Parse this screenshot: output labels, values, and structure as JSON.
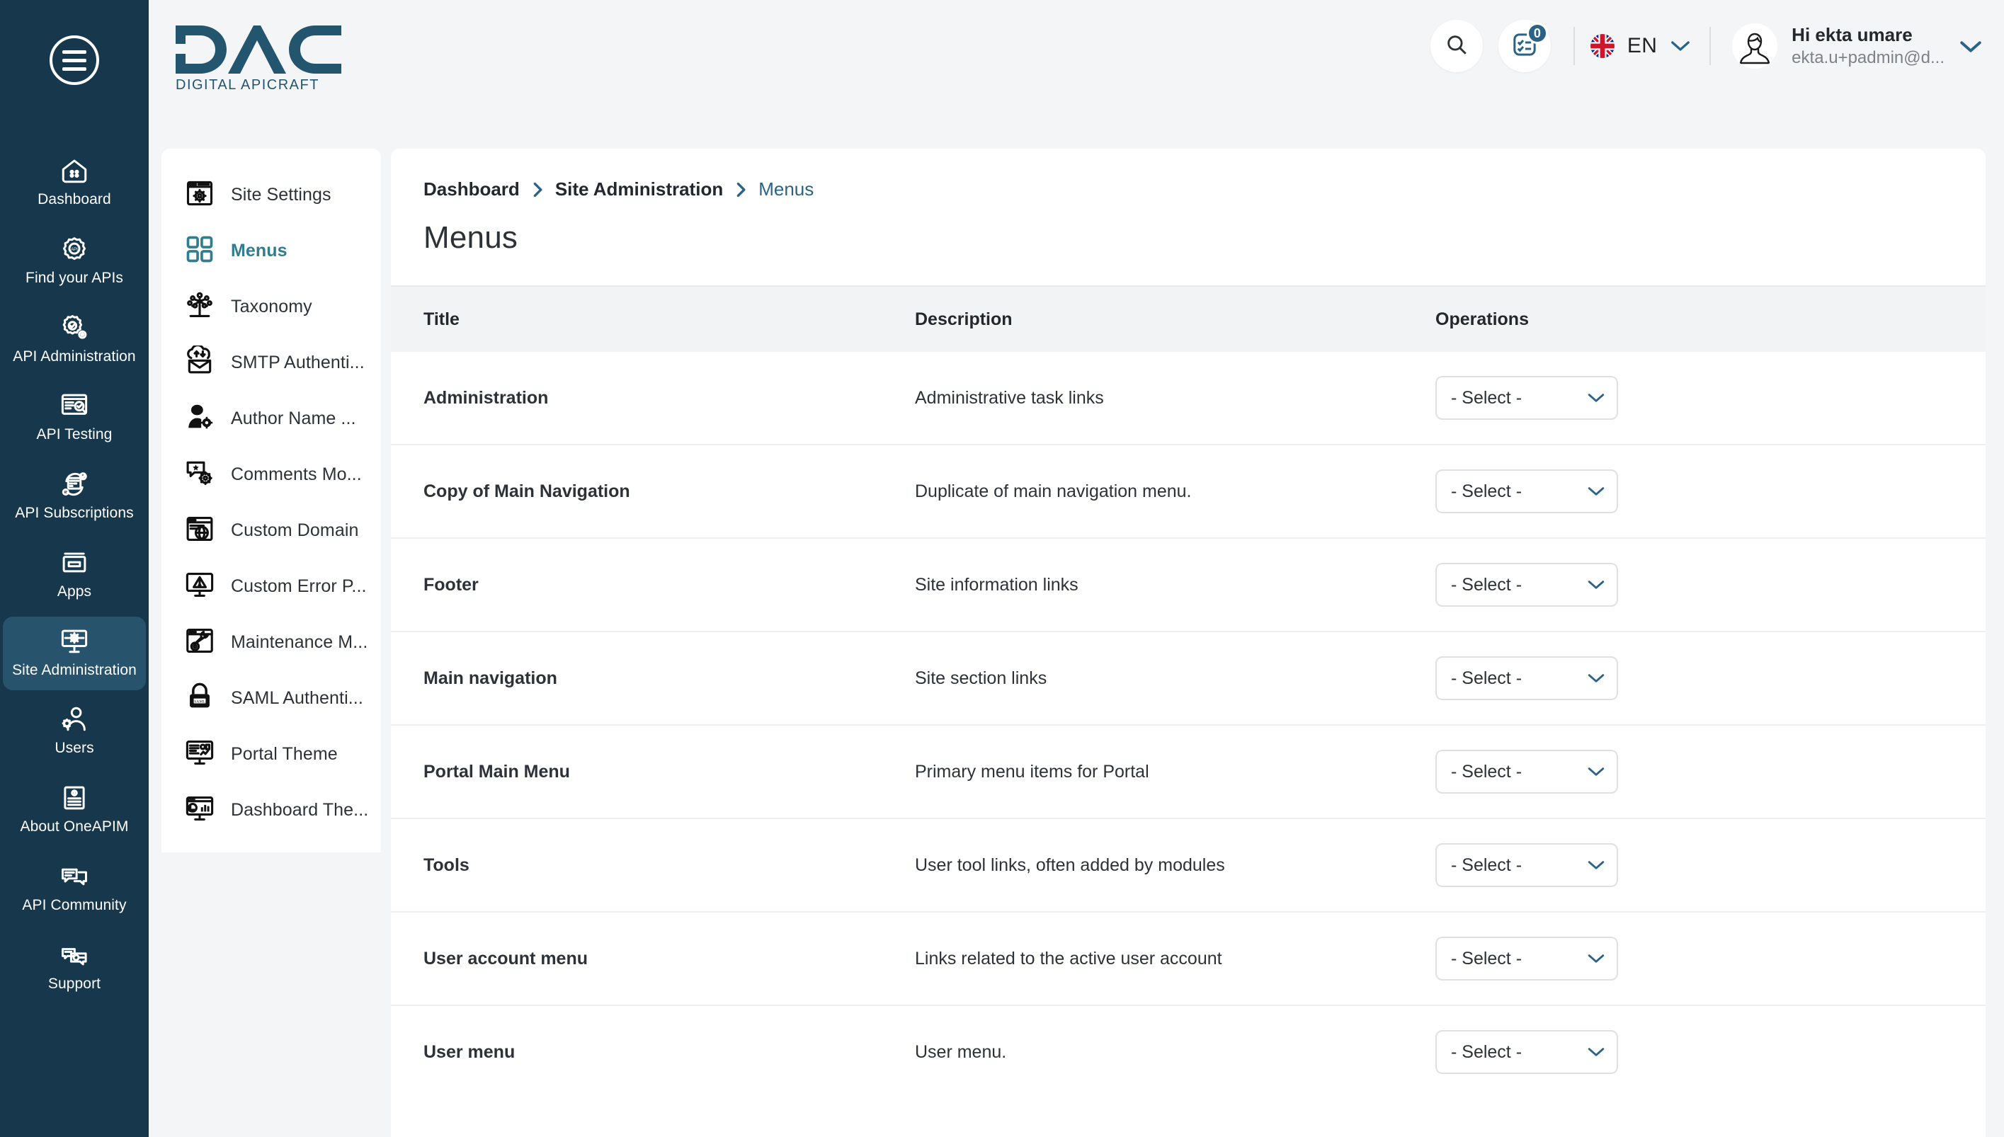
{
  "brand": {
    "logo_text": "DAC",
    "logo_tagline": "DIGITAL APICRAFT",
    "accent_teal": "#2f7d8e",
    "accent_blue": "#2b6387",
    "rail_bg": "#17374d",
    "rail_active_bg": "#27536d"
  },
  "rail": {
    "menu_icon": "hamburger-icon",
    "items": [
      {
        "label": "Dashboard",
        "icon": "dashboard-icon",
        "active": false
      },
      {
        "label": "Find your APIs",
        "icon": "find-apis-icon",
        "active": false
      },
      {
        "label": "API Administration",
        "icon": "api-administration-icon",
        "active": false
      },
      {
        "label": "API Testing",
        "icon": "api-testing-icon",
        "active": false
      },
      {
        "label": "API Subscriptions",
        "icon": "api-subscriptions-icon",
        "active": false
      },
      {
        "label": "Apps",
        "icon": "apps-icon",
        "active": false
      },
      {
        "label": "Site Administration",
        "icon": "site-administration-icon",
        "active": true
      },
      {
        "label": "Users",
        "icon": "users-icon",
        "active": false
      },
      {
        "label": "About OneAPIM",
        "icon": "about-icon",
        "active": false
      },
      {
        "label": "API Community",
        "icon": "community-icon",
        "active": false
      },
      {
        "label": "Support",
        "icon": "support-icon",
        "active": false
      }
    ]
  },
  "topbar": {
    "search_icon": "search-icon",
    "notifications_icon": "tasks-icon",
    "notifications_count": "0",
    "language": {
      "code": "EN",
      "flag": "uk-flag-icon",
      "chevron": "chevron-down-icon"
    },
    "profile": {
      "avatar": "user-avatar-icon",
      "greeting": "Hi ekta umare",
      "email": "ekta.u+padmin@d...",
      "chevron": "chevron-down-icon"
    }
  },
  "subnav": {
    "items": [
      {
        "label": "Site Settings",
        "icon": "site-settings-icon",
        "active": false
      },
      {
        "label": "Menus",
        "icon": "menus-grid-icon",
        "active": true
      },
      {
        "label": "Taxonomy",
        "icon": "taxonomy-tree-icon",
        "active": false
      },
      {
        "label": "SMTP Authenti...",
        "icon": "smtp-mail-icon",
        "active": false
      },
      {
        "label": "Author Name ...",
        "icon": "author-name-icon",
        "active": false
      },
      {
        "label": "Comments Mo...",
        "icon": "comments-moderation-icon",
        "active": false
      },
      {
        "label": "Custom Domain",
        "icon": "custom-domain-icon",
        "active": false
      },
      {
        "label": "Custom Error P...",
        "icon": "custom-error-page-icon",
        "active": false
      },
      {
        "label": "Maintenance M...",
        "icon": "maintenance-mode-icon",
        "active": false
      },
      {
        "label": "SAML Authenti...",
        "icon": "saml-lock-icon",
        "active": false
      },
      {
        "label": "Portal Theme",
        "icon": "portal-theme-icon",
        "active": false
      },
      {
        "label": "Dashboard The...",
        "icon": "dashboard-theme-icon",
        "active": false
      }
    ]
  },
  "breadcrumb": [
    {
      "label": "Dashboard",
      "current": false
    },
    {
      "label": "Site Administration",
      "current": false
    },
    {
      "label": "Menus",
      "current": true
    }
  ],
  "page": {
    "title": "Menus"
  },
  "table": {
    "columns": [
      "Title",
      "Description",
      "Operations"
    ],
    "select_placeholder": "- Select -",
    "rows": [
      {
        "title": "Administration",
        "description": "Administrative task links",
        "operation": "- Select -"
      },
      {
        "title": "Copy of Main Navigation",
        "description": "Duplicate of main navigation menu.",
        "operation": "- Select -"
      },
      {
        "title": "Footer",
        "description": "Site information links",
        "operation": "- Select -"
      },
      {
        "title": "Main navigation",
        "description": "Site section links",
        "operation": "- Select -"
      },
      {
        "title": "Portal Main Menu",
        "description": "Primary menu items for Portal",
        "operation": "- Select -"
      },
      {
        "title": "Tools",
        "description": "User tool links, often added by modules",
        "operation": "- Select -"
      },
      {
        "title": "User account menu",
        "description": "Links related to the active user account",
        "operation": "- Select -"
      },
      {
        "title": "User menu",
        "description": "User menu.",
        "operation": "- Select -"
      }
    ]
  }
}
